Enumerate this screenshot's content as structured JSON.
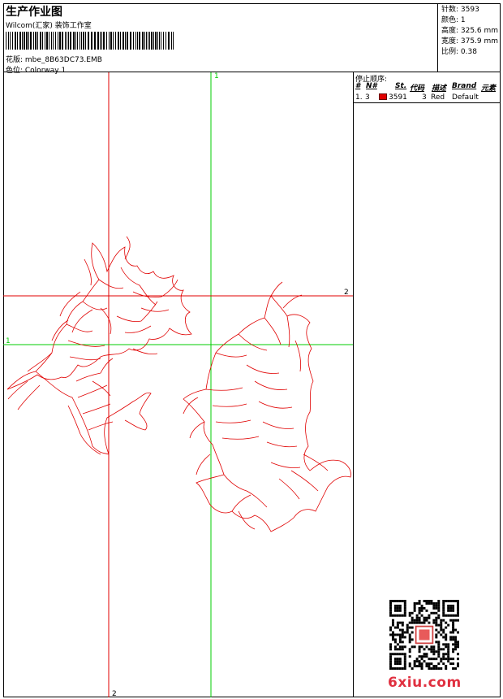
{
  "header": {
    "title": "生产作业图",
    "subtitle": "Wilcom(汇家) 装饰工作室",
    "pattern": "花版: mbe_8B63DC73.EMB",
    "colorway": "色位: Colorway 1"
  },
  "stats": {
    "stitches": "针数: 3593",
    "colors": "颜色: 1",
    "height": "高度: 325.6 mm",
    "width": "宽度: 375.9 mm",
    "scale": "比例: 0.38"
  },
  "stop_sequence": {
    "title": "停止顺序:",
    "columns": [
      "#",
      "N#",
      "St.",
      "代码",
      "描述",
      "Brand",
      "元素"
    ],
    "rows": [
      {
        "index": "1.",
        "needle": "3",
        "color_hex": "#e00000",
        "stitches": "3591",
        "code": "3",
        "description": "Red",
        "brand": "Default"
      }
    ]
  },
  "guides": {
    "vertical_red_label": "2",
    "vertical_green_label": "1",
    "horizontal_red_label": "2",
    "horizontal_green_label": "1",
    "red_color": "#e00000",
    "green_color": "#00cc00"
  },
  "watermark": {
    "site": "6xiu.com"
  }
}
